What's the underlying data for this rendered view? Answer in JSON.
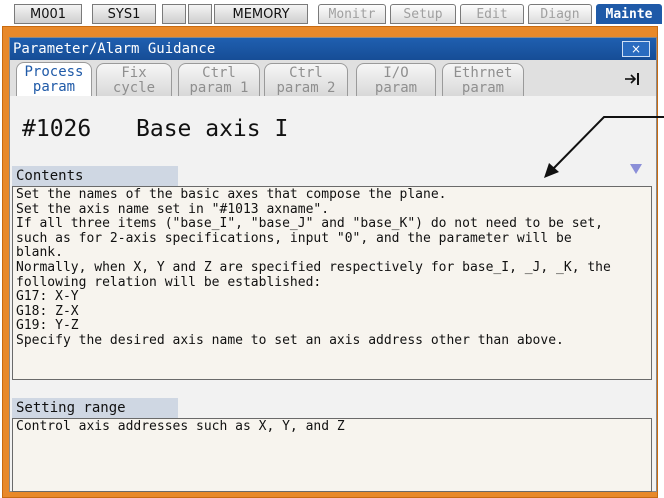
{
  "topbar": {
    "m001": "M001",
    "sys1": "SYS1",
    "memory": "MEMORY",
    "menus": [
      "Monitr",
      "Setup",
      "Edit",
      "Diagn",
      "Mainte"
    ]
  },
  "window": {
    "title": "Parameter/Alarm Guidance",
    "close": "×"
  },
  "tabs": [
    {
      "line1": "Process",
      "line2": "param"
    },
    {
      "line1": "Fix",
      "line2": "cycle"
    },
    {
      "line1": "Ctrl",
      "line2": "param 1"
    },
    {
      "line1": "Ctrl",
      "line2": "param 2"
    },
    {
      "line1": "I/O",
      "line2": "param"
    },
    {
      "line1": "Ethrnet",
      "line2": "param"
    }
  ],
  "tab_arrow": "→",
  "parameter": {
    "number": "#1026",
    "name": "Base axis I"
  },
  "contents": {
    "header": "Contents",
    "text": "Set the names of the basic axes that compose the plane.\nSet the axis name set in \"#1013 axname\".\nIf all three items (\"base_I\", \"base_J\" and \"base_K\") do not need to be set,\nsuch as for 2-axis specifications, input \"0\", and the parameter will be\nblank.\nNormally, when X, Y and Z are specified respectively for base_I, _J, _K, the\nfollowing relation will be established:\nG17: X-Y\nG18: Z-X\nG19: Y-Z\nSpecify the desired axis name to set an axis address other than above."
  },
  "setting_range": {
    "header": "Setting range",
    "text": "Control axis addresses such as X, Y, and Z"
  },
  "colors": {
    "frame": "#e8892a",
    "titlebar": "#1f5fb0",
    "active_menu": "#1f5aa8"
  }
}
